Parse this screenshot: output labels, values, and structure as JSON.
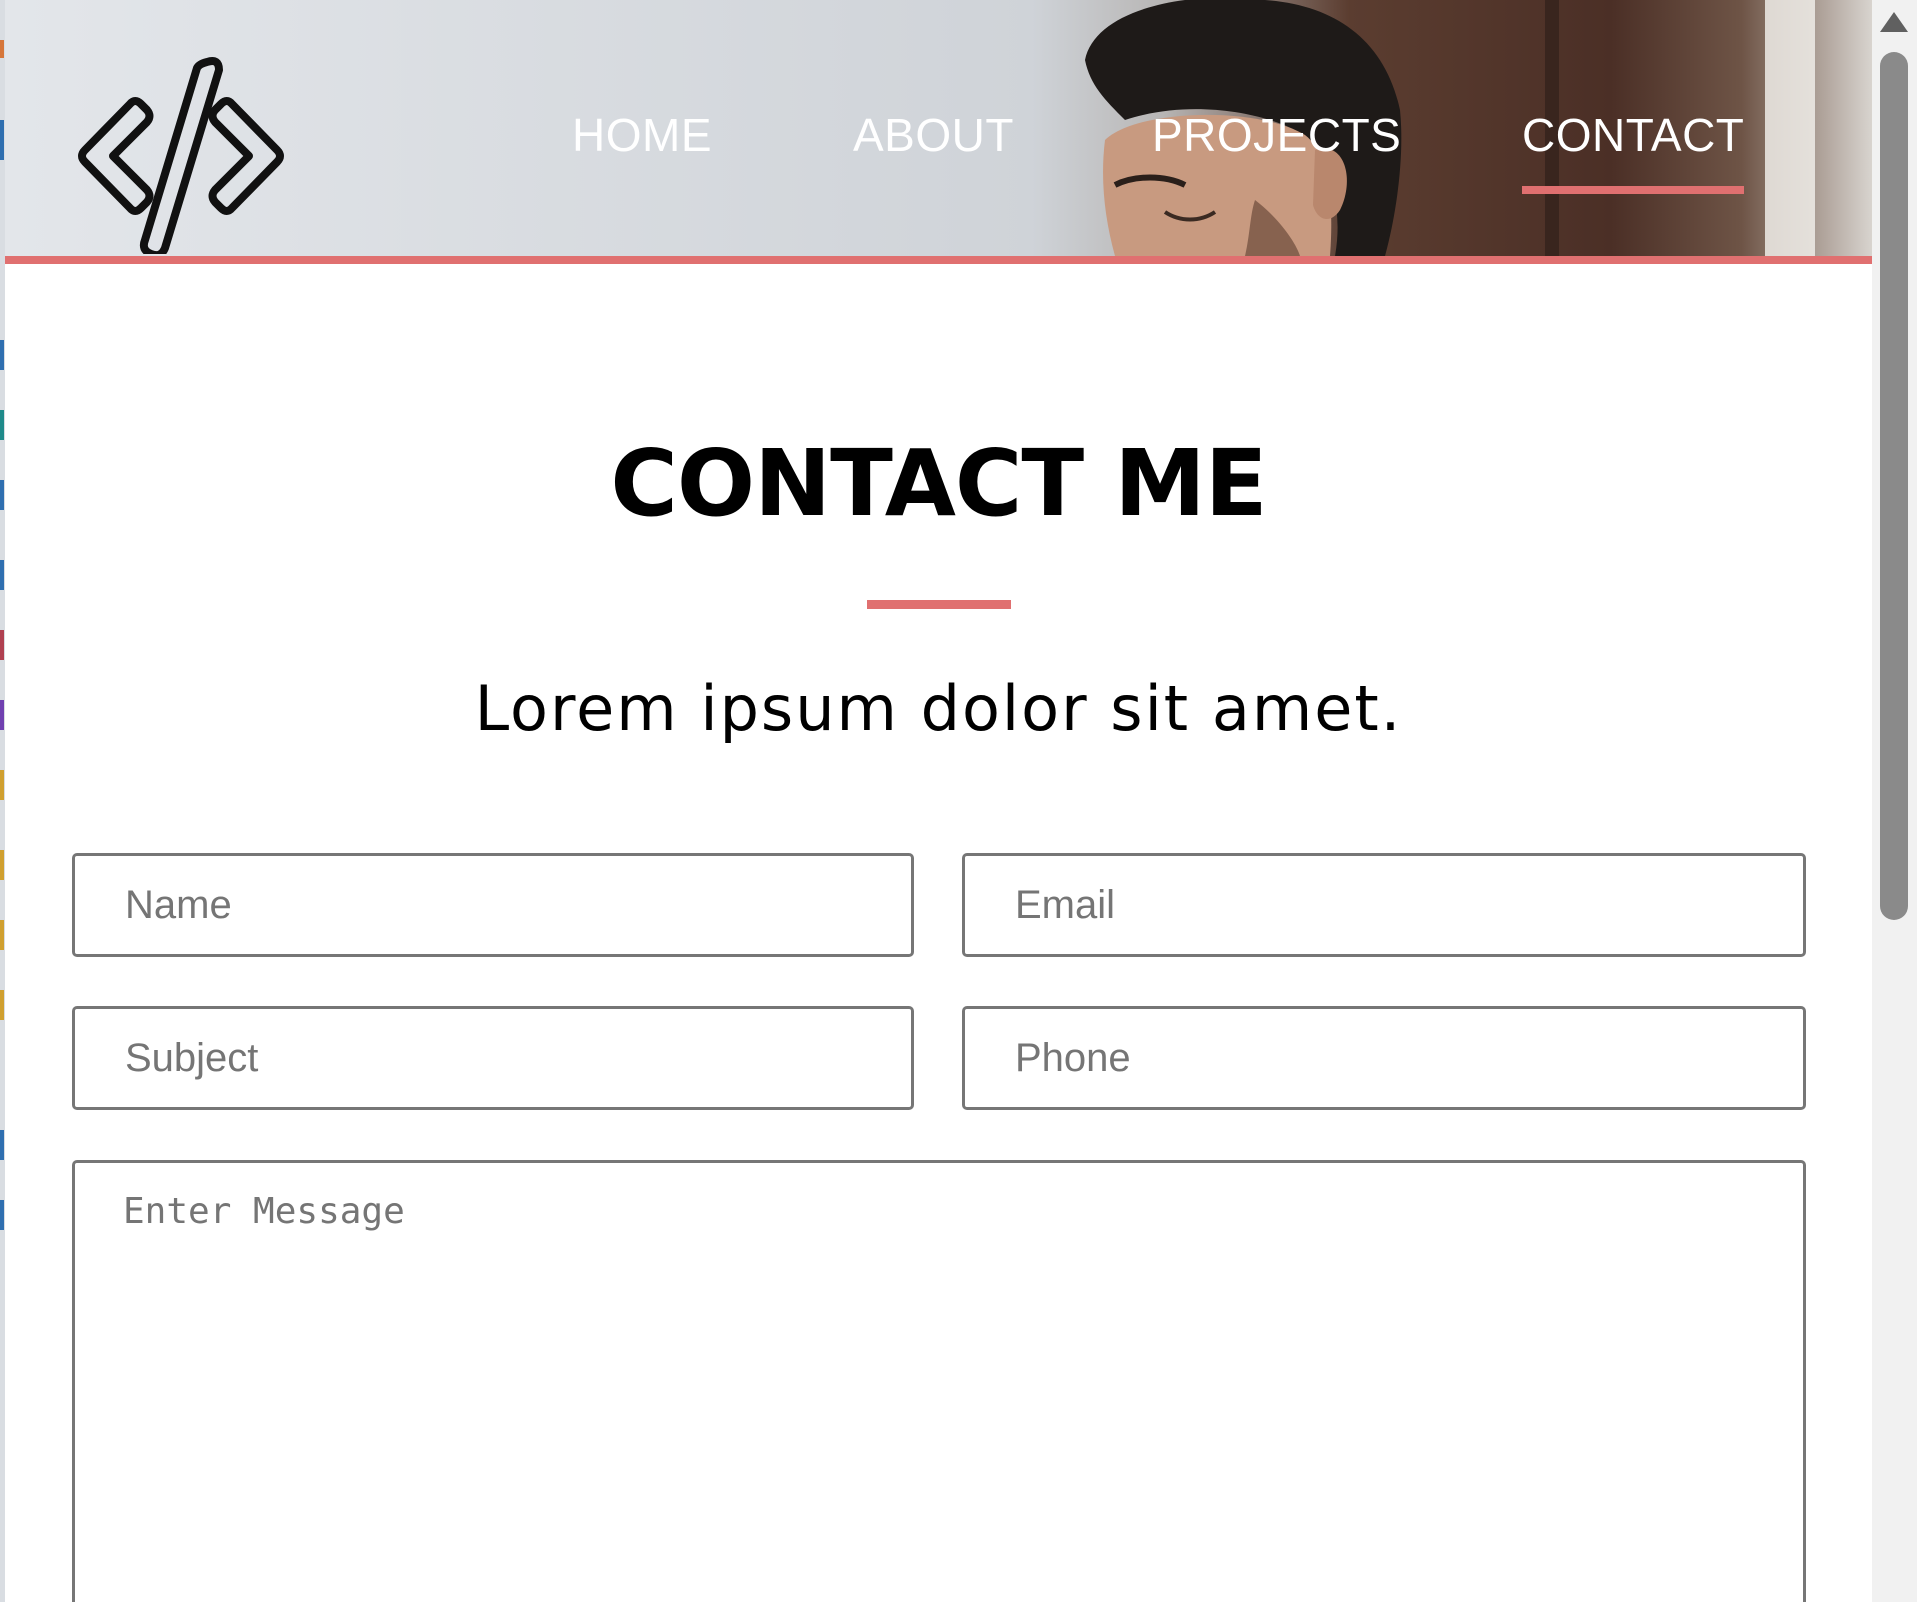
{
  "nav": {
    "items": [
      {
        "label": "HOME"
      },
      {
        "label": "ABOUT"
      },
      {
        "label": "PROJECTS"
      },
      {
        "label": "CONTACT",
        "active": true
      }
    ]
  },
  "contact": {
    "title": "CONTACT ME",
    "subtitle": "Lorem ipsum dolor sit amet.",
    "form": {
      "name_placeholder": "Name",
      "email_placeholder": "Email",
      "subject_placeholder": "Subject",
      "phone_placeholder": "Phone",
      "message_placeholder": "Enter Message"
    }
  },
  "colors": {
    "accent": "#e07070",
    "nav_text": "#ffffff",
    "field_border": "#767676",
    "placeholder": "#757575"
  },
  "icons": {
    "logo": "code-brackets-icon",
    "scroll_up": "scroll-up-arrow-icon"
  }
}
